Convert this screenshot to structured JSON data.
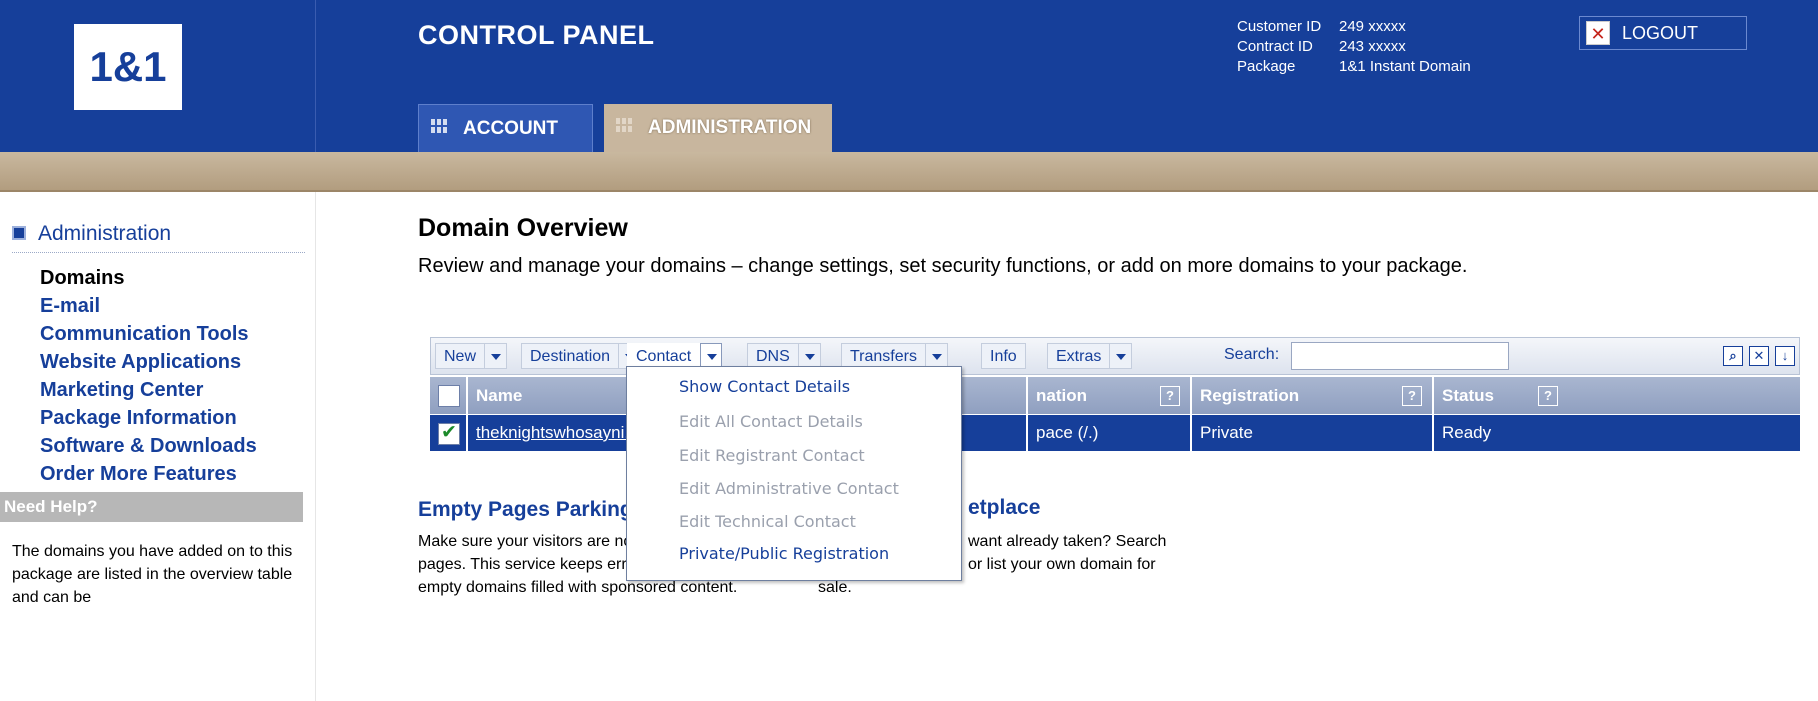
{
  "header": {
    "logo_text": "1&1",
    "title": "CONTROL PANEL",
    "tabs": [
      {
        "label": "ACCOUNT",
        "active": false
      },
      {
        "label": "ADMINISTRATION",
        "active": true
      }
    ],
    "customer": {
      "customer_id_label": "Customer ID",
      "customer_id_value": "249 xxxxx",
      "contract_id_label": "Contract ID",
      "contract_id_value": "243 xxxxx",
      "package_label": "Package",
      "package_value": "1&1 Instant Domain"
    },
    "logout_label": "LOGOUT"
  },
  "sidebar": {
    "heading": "Administration",
    "items": [
      {
        "label": "Domains",
        "active": true
      },
      {
        "label": "E-mail",
        "active": false
      },
      {
        "label": "Communication Tools",
        "active": false
      },
      {
        "label": "Website Applications",
        "active": false
      },
      {
        "label": "Marketing Center",
        "active": false
      },
      {
        "label": "Package Information",
        "active": false
      },
      {
        "label": "Software & Downloads",
        "active": false
      },
      {
        "label": "Order More Features",
        "active": false
      }
    ],
    "help_heading": "Need Help?",
    "help_text": "The domains you have added on to this package are listed in the overview table and can be"
  },
  "main": {
    "title": "Domain Overview",
    "description": "Review and manage your domains – change settings, set security functions, or add on more domains to your package.",
    "toolbar": {
      "buttons": [
        "New",
        "Destination",
        "Contact",
        "DNS",
        "Transfers",
        "Info",
        "Extras"
      ],
      "search_label": "Search:",
      "search_value": ""
    },
    "table": {
      "headers": [
        "Name",
        "nation",
        "Registration",
        "Status"
      ],
      "rows": [
        {
          "name": "theknightswhosayni.info",
          "destination": "pace (/.)",
          "registration": "Private",
          "status": "Ready",
          "checked": true
        }
      ]
    },
    "contact_menu": {
      "items": [
        {
          "label": "Show Contact Details",
          "enabled": true
        },
        {
          "label": "Edit All Contact Details",
          "enabled": false
        },
        {
          "label": "Edit Registrant Contact",
          "enabled": false
        },
        {
          "label": "Edit Administrative Contact",
          "enabled": false
        },
        {
          "label": "Edit Technical Contact",
          "enabled": false
        },
        {
          "label": "Private/Public Registration",
          "enabled": true
        }
      ]
    },
    "parking": {
      "title": "Empty Pages Parking",
      "line1": "Make sure your visitors are not",
      "line2": "pages. This service keeps erro",
      "line3": "empty domains filled with sponsored content."
    },
    "marketplace": {
      "title": "etplace",
      "line1": "want already taken? Search",
      "line2": "or list your own domain for",
      "line3": "sale."
    }
  },
  "colors": {
    "brand_blue": "#163f9a",
    "tan": "#c4b296",
    "header_gray": "#98a7c6"
  }
}
